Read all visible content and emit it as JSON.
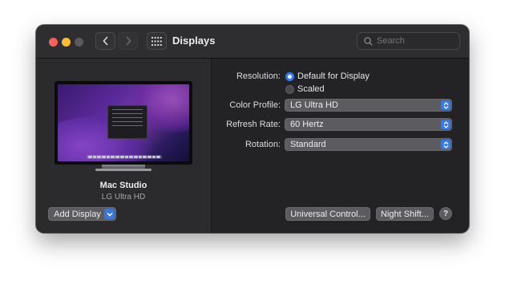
{
  "window": {
    "title": "Displays",
    "search_placeholder": "Search"
  },
  "icons": {
    "back": "chevron-left-icon",
    "forward": "chevron-right-icon",
    "grid": "grid-icon",
    "search": "search-icon"
  },
  "display": {
    "name": "Mac Studio",
    "model": "LG Ultra HD"
  },
  "buttons": {
    "add_display": "Add Display",
    "universal_control": "Universal Control...",
    "night_shift": "Night Shift...",
    "help": "?"
  },
  "settings": {
    "resolution_label": "Resolution:",
    "resolution_options": [
      {
        "label": "Default for Display",
        "selected": true
      },
      {
        "label": "Scaled",
        "selected": false
      }
    ],
    "color_profile_label": "Color Profile:",
    "color_profile_value": "LG Ultra HD",
    "refresh_rate_label": "Refresh Rate:",
    "refresh_rate_value": "60 Hertz",
    "rotation_label": "Rotation:",
    "rotation_value": "Standard"
  },
  "colors": {
    "accent": "#2f7bf5",
    "window_bg": "#232326",
    "close": "#ff5f57",
    "minimize": "#febc2e"
  }
}
